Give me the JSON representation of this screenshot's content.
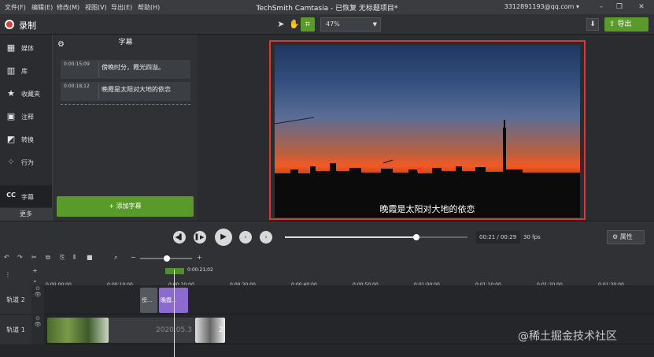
{
  "menubar": {
    "items": [
      "文件(F)",
      "编辑(E)",
      "修改(M)",
      "视图(V)",
      "导出(E)",
      "帮助(H)"
    ],
    "title": "TechSmith Camtasia - 已恢复  无标题项目*",
    "account": "3312891193@qq.com ▾"
  },
  "toolbar": {
    "record_label": "录制",
    "zoom_value": "47%",
    "export_label": "导出"
  },
  "leftnav": {
    "items": [
      {
        "label": "媒体",
        "icon": "media-icon"
      },
      {
        "label": "库",
        "icon": "library-icon"
      },
      {
        "label": "收藏夹",
        "icon": "star-icon"
      },
      {
        "label": "注释",
        "icon": "annotation-icon"
      },
      {
        "label": "转换",
        "icon": "transition-icon"
      },
      {
        "label": "行为",
        "icon": "behavior-icon"
      },
      {
        "label": "字幕",
        "icon": "cc-icon"
      }
    ],
    "more_label": "更多"
  },
  "captions": {
    "title": "字幕",
    "items": [
      {
        "time": "0:00:15;09",
        "text": "傍晚时分，霞光四溢。"
      },
      {
        "time": "0:00:18;12",
        "text": "晚霞是太阳对大地的依恋"
      }
    ],
    "add_label": "+ 添加字幕"
  },
  "canvas": {
    "subtitle": "晚霞是太阳对大地的依恋"
  },
  "player": {
    "current": "00:21",
    "total": "00:29",
    "time_display": "00:21 / 00:29",
    "fps": "30 fps",
    "progress": 0.72,
    "properties_label": "属性"
  },
  "timeline": {
    "playhead_time": "0:00:21;02",
    "ruler_labels": [
      "0:00:00;00",
      "0:00:10;00",
      "0:00:20;00",
      "0:00:30;00",
      "0:00:40;00",
      "0:00:50;00",
      "0:01:00;00",
      "0:01:10;00",
      "0:01:20;00",
      "0:01:30;00"
    ],
    "tracks": [
      {
        "label": "轨道 2",
        "clips": [
          {
            "text": "傍..."
          },
          {
            "text": "晚霞..."
          }
        ]
      },
      {
        "label": "轨道 1",
        "clips": [
          {
            "text": ""
          },
          {
            "text": ""
          },
          {
            "text": "2020.05.3"
          },
          {
            "text": "2"
          }
        ]
      }
    ]
  },
  "watermark": "@稀土掘金技术社区",
  "colors": {
    "accent": "#5a9a2a",
    "record": "#e03a3a",
    "annotation": "#e03535"
  }
}
